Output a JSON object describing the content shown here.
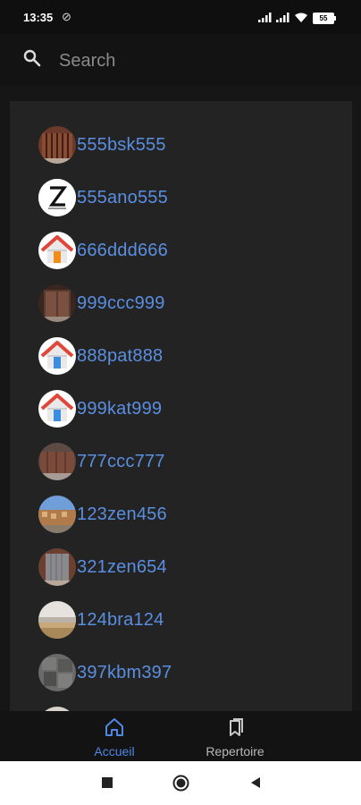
{
  "status_bar": {
    "time": "13:35",
    "battery": "55"
  },
  "search": {
    "placeholder": "Search"
  },
  "list": {
    "items": [
      {
        "label": "555bsk555",
        "avatar": "gate-brown"
      },
      {
        "label": "555ano555",
        "avatar": "z-logo"
      },
      {
        "label": "666ddd666",
        "avatar": "house-icon"
      },
      {
        "label": "999ccc999",
        "avatar": "gate-dark"
      },
      {
        "label": "888pat888",
        "avatar": "house-icon"
      },
      {
        "label": "999kat999",
        "avatar": "house-icon"
      },
      {
        "label": "777ccc777",
        "avatar": "gate-rust"
      },
      {
        "label": "123zen456",
        "avatar": "street-photo"
      },
      {
        "label": "321zen654",
        "avatar": "gate-door"
      },
      {
        "label": "124bra124",
        "avatar": "landscape-photo"
      },
      {
        "label": "397kbm397",
        "avatar": "stone-photo"
      }
    ]
  },
  "bottom_nav": {
    "home_label": "Accueil",
    "directory_label": "Repertoire"
  },
  "colors": {
    "accent": "#4f87e3",
    "link": "#5a8ee0",
    "background": "#161616",
    "panel": "#232323"
  }
}
